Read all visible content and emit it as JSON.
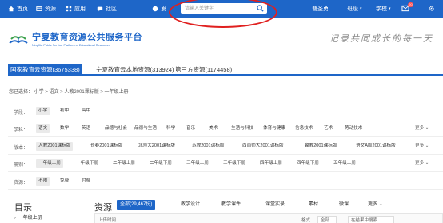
{
  "topnav": {
    "items": [
      {
        "label": "首页",
        "icon": "home-icon"
      },
      {
        "label": "资源",
        "icon": "resource-icon"
      },
      {
        "label": "应用",
        "icon": "apps-icon"
      },
      {
        "label": "社区",
        "icon": "community-icon"
      },
      {
        "label": "发",
        "icon": "publish-icon"
      }
    ],
    "search_placeholder": "请输入关键字",
    "user_name": "曹圣勇",
    "class_menu": "班级",
    "school_menu": "学校",
    "message_badge": "20"
  },
  "header": {
    "logo_title": "宁夏教育资源公共服务平台",
    "logo_subtitle": "NingXia Public Service Platform of Educational Resources",
    "slogan": "记录共同成长的每一天"
  },
  "resource_tabs": [
    {
      "label": "国家教育云资源(3675338)",
      "active": true
    },
    {
      "label": "宁夏教育云本地资源(313924)",
      "active": false
    },
    {
      "label": "第三方资源(1174458)",
      "active": false
    }
  ],
  "breadcrumb": "您已选择： 小学 > 语文 > 人教2001课标版 > 一年级上册",
  "filters": [
    {
      "label": "学段：",
      "options": [
        "小学",
        "初中",
        "高中"
      ],
      "selected": 0,
      "more": ""
    },
    {
      "label": "学科：",
      "options": [
        "语文",
        "数学",
        "英语",
        "品德与社会",
        "品德与生活",
        "科学",
        "音乐",
        "美术",
        "生活与科技",
        "体育与健康",
        "信息技术",
        "艺术",
        "劳动技术"
      ],
      "selected": 0,
      "more": "更多"
    },
    {
      "label": "版本：",
      "options": [
        "人教2001课标版",
        "长春2001课标版",
        "北师大2001课标版",
        "苏教2001课标版",
        "西南师大2001课标版",
        "冀教2001课标版",
        "语文A版2001课标版"
      ],
      "selected": 0,
      "more": "更多"
    },
    {
      "label": "册别：",
      "options": [
        "一年级上册",
        "一年级下册",
        "二年级上册",
        "二年级下册",
        "三年级上册",
        "三年级下册",
        "四年级上册",
        "四年级下册",
        "五年级上册"
      ],
      "selected": 0,
      "more": "更多"
    },
    {
      "label": "资源：",
      "options": [
        "不限",
        "免费",
        "付费"
      ],
      "selected": 0,
      "more": ""
    }
  ],
  "toc": {
    "title": "目录",
    "first_item": "一年级上册"
  },
  "resources": {
    "title": "资源",
    "tabs": [
      "全部(29,467份)",
      "教学设计",
      "教学课件",
      "课堂实录",
      "素材",
      "微课",
      "更多"
    ],
    "row_head": "上传时间",
    "row_format_label": "格式",
    "row_format_value": "全部",
    "row_search_placeholder": "在结果中搜索"
  },
  "colors": {
    "brand": "#1e66c8",
    "annotation": "#e0201f"
  }
}
